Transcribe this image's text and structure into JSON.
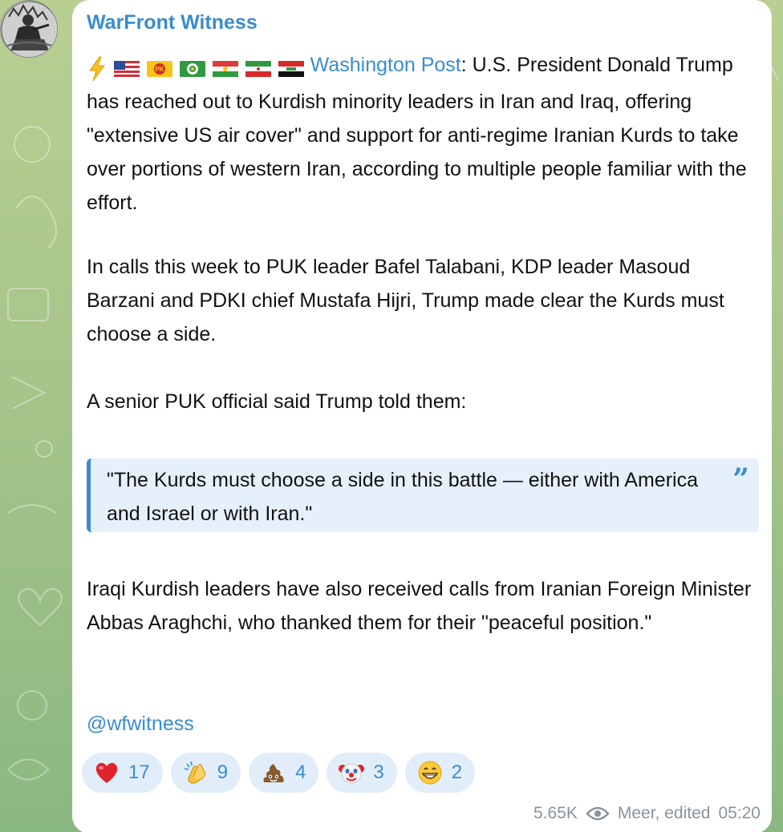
{
  "channel": {
    "name": "WarFront Witness"
  },
  "post": {
    "flag_icons": [
      "lightning-icon",
      "us-flag-icon",
      "pkk-flag-icon",
      "pdki-flag-icon",
      "kurdistan-flag-icon",
      "iran-flag-icon",
      "iraq-flag-icon"
    ],
    "source_link": "Washington Post",
    "p1_rest": ": U.S. President Donald Trump has reached out to Kurdish minority leaders in Iran and Iraq, offering \"extensive US air cover\" and support for anti-regime Iranian Kurds to take over portions of western Iran, according to multiple people familiar with the effort.",
    "p2": "In calls this week to PUK leader Bafel Talabani, KDP leader Masoud Barzani and PDKI chief Mustafa Hijri, Trump made clear the Kurds must choose a side.",
    "p3": "A senior PUK official said Trump told them:",
    "quote": "\"The Kurds must choose a side in this battle — either with America and Israel or with Iran.\"",
    "p4": "Iraqi Kurdish leaders have also received calls from Iranian Foreign Minister Abbas Araghchi, who thanked them for their \"peaceful position.\"",
    "signature": "@wfwitness"
  },
  "reactions": [
    {
      "icon": "heart-icon",
      "count": "17"
    },
    {
      "icon": "clapping-hands-icon",
      "count": "9"
    },
    {
      "icon": "pile-of-poo-icon",
      "count": "4"
    },
    {
      "icon": "clown-face-icon",
      "count": "3"
    },
    {
      "icon": "grinning-face-icon",
      "count": "2"
    }
  ],
  "meta": {
    "views": "5.65K",
    "author": "Meer, edited",
    "time": "05:20"
  },
  "colors": {
    "accent": "#3a8ccf",
    "quote_bg": "#e6f0fb",
    "reaction_bg": "#e1eefa",
    "meta_text": "#8a949c",
    "wallpaper": "#a9c68b"
  }
}
